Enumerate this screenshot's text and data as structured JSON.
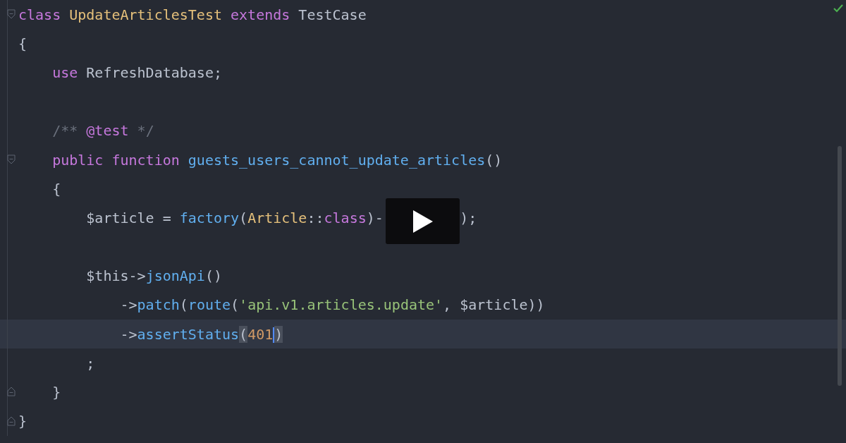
{
  "editor": {
    "lines": [
      {
        "gutter": {
          "kind": "open"
        },
        "current": false,
        "tokens": [
          {
            "t": "class ",
            "kind": "keyword"
          },
          {
            "t": "UpdateArticlesTest ",
            "kind": "class"
          },
          {
            "t": "extends ",
            "kind": "keyword"
          },
          {
            "t": "TestCase",
            "kind": "plain"
          }
        ]
      },
      {
        "current": false,
        "tokens": [
          {
            "t": "{",
            "kind": "plain"
          }
        ]
      },
      {
        "current": false,
        "tokens": [
          {
            "t": "    use ",
            "kind": "keyword"
          },
          {
            "t": "RefreshDatabase;",
            "kind": "plain"
          }
        ]
      },
      {
        "current": false
      },
      {
        "current": false,
        "tokens": [
          {
            "t": "    /** ",
            "kind": "comment"
          },
          {
            "t": "@test",
            "kind": "keyword"
          },
          {
            "t": " */",
            "kind": "comment"
          }
        ]
      },
      {
        "gutter": {
          "kind": "open"
        },
        "current": false,
        "tokens": [
          {
            "t": "    public function ",
            "kind": "keyword"
          },
          {
            "t": "guests_users_cannot_update_articles",
            "kind": "fn"
          },
          {
            "t": "()",
            "kind": "plain"
          }
        ]
      },
      {
        "current": false,
        "tokens": [
          {
            "t": "    {",
            "kind": "plain"
          }
        ]
      },
      {
        "current": false,
        "tokens": [
          {
            "t": "        $article = ",
            "kind": "plain"
          },
          {
            "t": "factory",
            "kind": "fn"
          },
          {
            "t": "(",
            "kind": "plain"
          },
          {
            "t": "Article",
            "kind": "class"
          },
          {
            "t": "::",
            "kind": "plain"
          },
          {
            "t": "class",
            "kind": "keyword"
          },
          {
            "t": ")-",
            "kind": "plain"
          },
          {
            "kind": "gap"
          },
          {
            "t": ");",
            "kind": "plain"
          }
        ]
      },
      {
        "current": false
      },
      {
        "current": false,
        "tokens": [
          {
            "t": "        $this->",
            "kind": "plain"
          },
          {
            "t": "jsonApi",
            "kind": "fn"
          },
          {
            "t": "()",
            "kind": "plain"
          }
        ]
      },
      {
        "current": false,
        "tokens": [
          {
            "t": "            ->",
            "kind": "plain"
          },
          {
            "t": "patch",
            "kind": "fn"
          },
          {
            "t": "(",
            "kind": "plain"
          },
          {
            "t": "route",
            "kind": "fn"
          },
          {
            "t": "(",
            "kind": "plain"
          },
          {
            "t": "'api.v1.articles.update'",
            "kind": "string"
          },
          {
            "t": ", $article))",
            "kind": "plain"
          }
        ]
      },
      {
        "current": true,
        "tokens": [
          {
            "t": "            ->",
            "kind": "plain"
          },
          {
            "t": "assertStatus",
            "kind": "fn"
          },
          {
            "t": "(",
            "kind": "plain",
            "matched": true
          },
          {
            "t": "401",
            "kind": "number",
            "caret": true
          },
          {
            "t": ")",
            "kind": "plain",
            "matched": true
          }
        ]
      },
      {
        "current": false,
        "tokens": [
          {
            "t": "        ;",
            "kind": "plain"
          }
        ]
      },
      {
        "gutter": {
          "kind": "close"
        },
        "current": false,
        "tokens": [
          {
            "t": "    }",
            "kind": "plain"
          }
        ]
      },
      {
        "gutter": {
          "kind": "close"
        },
        "current": false,
        "tokens": [
          {
            "t": "}",
            "kind": "plain"
          }
        ]
      }
    ]
  }
}
